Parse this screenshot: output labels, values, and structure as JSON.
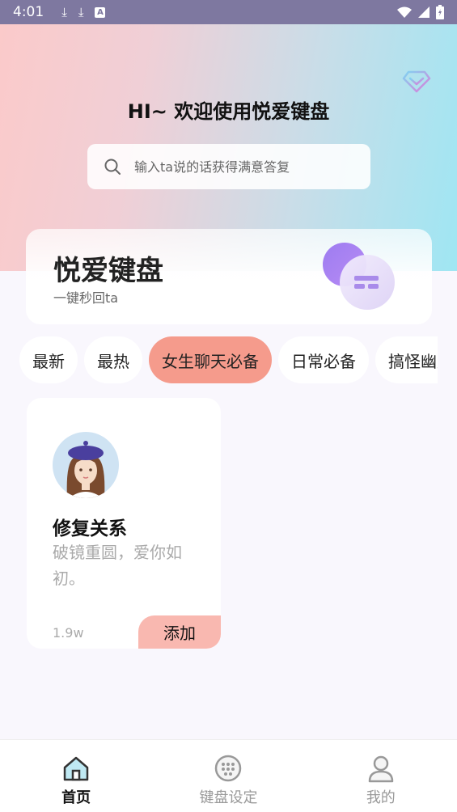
{
  "status_bar": {
    "time": "4:01",
    "notif_icons": [
      "download-icon",
      "download-icon",
      "a-box-icon"
    ],
    "right_icons": [
      "wifi-icon",
      "signal-icon",
      "battery-icon"
    ]
  },
  "header": {
    "welcome": "HI~ 欢迎使用悦爱键盘",
    "vip_icon": "diamond-icon"
  },
  "search": {
    "placeholder": "输入ta说的话获得满意答复"
  },
  "promo": {
    "title": "悦爱键盘",
    "subtitle": "一键秒回ta"
  },
  "tabs": [
    {
      "label": "最新",
      "active": false
    },
    {
      "label": "最热",
      "active": false
    },
    {
      "label": "女生聊天必备",
      "active": true
    },
    {
      "label": "日常必备",
      "active": false
    },
    {
      "label": "搞怪幽默",
      "active": false
    }
  ],
  "card": {
    "title": "修复关系",
    "description": "破镜重圆，爱你如初。",
    "count": "1.9w",
    "add_label": "添加"
  },
  "nav": [
    {
      "label": "首页",
      "icon": "home-icon",
      "active": true
    },
    {
      "label": "键盘设定",
      "icon": "keyboard-icon",
      "active": false
    },
    {
      "label": "我的",
      "icon": "profile-icon",
      "active": false
    }
  ],
  "colors": {
    "accent_tab": "#f59b8c",
    "add_button": "#f9b8b0",
    "hero_left": "#fbcaca",
    "hero_right": "#9fe6f3"
  }
}
